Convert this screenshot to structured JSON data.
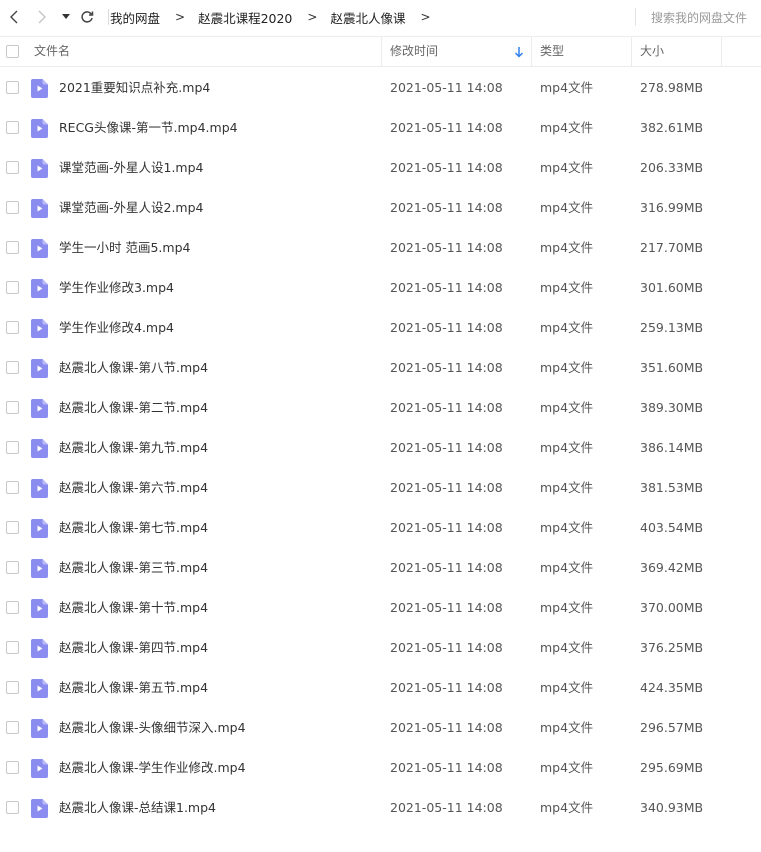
{
  "toolbar": {
    "back_icon": "chevron-left-icon",
    "forward_icon": "chevron-right-icon",
    "history_icon": "caret-down-icon",
    "refresh_icon": "refresh-icon",
    "breadcrumb": [
      "我的网盘",
      "赵震北课程2020",
      "赵震北人像课"
    ],
    "breadcrumb_separator": ">",
    "search_placeholder": "搜索我的网盘文件"
  },
  "columns": {
    "name": "文件名",
    "modified": "修改时间",
    "type": "类型",
    "size": "大小",
    "sort_column": "修改时间",
    "sort_direction": "descending"
  },
  "colors": {
    "file_icon": "#8a8cf0",
    "sort_arrow": "#2f7ff0"
  },
  "files": [
    {
      "name": "2021重要知识点补充.mp4",
      "modified": "2021-05-11 14:08",
      "type": "mp4文件",
      "size": "278.98MB"
    },
    {
      "name": "RECG头像课-第一节.mp4.mp4",
      "modified": "2021-05-11 14:08",
      "type": "mp4文件",
      "size": "382.61MB"
    },
    {
      "name": "课堂范画-外星人设1.mp4",
      "modified": "2021-05-11 14:08",
      "type": "mp4文件",
      "size": "206.33MB"
    },
    {
      "name": "课堂范画-外星人设2.mp4",
      "modified": "2021-05-11 14:08",
      "type": "mp4文件",
      "size": "316.99MB"
    },
    {
      "name": "学生一小时 范画5.mp4",
      "modified": "2021-05-11 14:08",
      "type": "mp4文件",
      "size": "217.70MB"
    },
    {
      "name": "学生作业修改3.mp4",
      "modified": "2021-05-11 14:08",
      "type": "mp4文件",
      "size": "301.60MB"
    },
    {
      "name": "学生作业修改4.mp4",
      "modified": "2021-05-11 14:08",
      "type": "mp4文件",
      "size": "259.13MB"
    },
    {
      "name": "赵震北人像课-第八节.mp4",
      "modified": "2021-05-11 14:08",
      "type": "mp4文件",
      "size": "351.60MB"
    },
    {
      "name": "赵震北人像课-第二节.mp4",
      "modified": "2021-05-11 14:08",
      "type": "mp4文件",
      "size": "389.30MB"
    },
    {
      "name": "赵震北人像课-第九节.mp4",
      "modified": "2021-05-11 14:08",
      "type": "mp4文件",
      "size": "386.14MB"
    },
    {
      "name": "赵震北人像课-第六节.mp4",
      "modified": "2021-05-11 14:08",
      "type": "mp4文件",
      "size": "381.53MB"
    },
    {
      "name": "赵震北人像课-第七节.mp4",
      "modified": "2021-05-11 14:08",
      "type": "mp4文件",
      "size": "403.54MB"
    },
    {
      "name": "赵震北人像课-第三节.mp4",
      "modified": "2021-05-11 14:08",
      "type": "mp4文件",
      "size": "369.42MB"
    },
    {
      "name": "赵震北人像课-第十节.mp4",
      "modified": "2021-05-11 14:08",
      "type": "mp4文件",
      "size": "370.00MB"
    },
    {
      "name": "赵震北人像课-第四节.mp4",
      "modified": "2021-05-11 14:08",
      "type": "mp4文件",
      "size": "376.25MB"
    },
    {
      "name": "赵震北人像课-第五节.mp4",
      "modified": "2021-05-11 14:08",
      "type": "mp4文件",
      "size": "424.35MB"
    },
    {
      "name": "赵震北人像课-头像细节深入.mp4",
      "modified": "2021-05-11 14:08",
      "type": "mp4文件",
      "size": "296.57MB"
    },
    {
      "name": "赵震北人像课-学生作业修改.mp4",
      "modified": "2021-05-11 14:08",
      "type": "mp4文件",
      "size": "295.69MB"
    },
    {
      "name": "赵震北人像课-总结课1.mp4",
      "modified": "2021-05-11 14:08",
      "type": "mp4文件",
      "size": "340.93MB"
    }
  ]
}
